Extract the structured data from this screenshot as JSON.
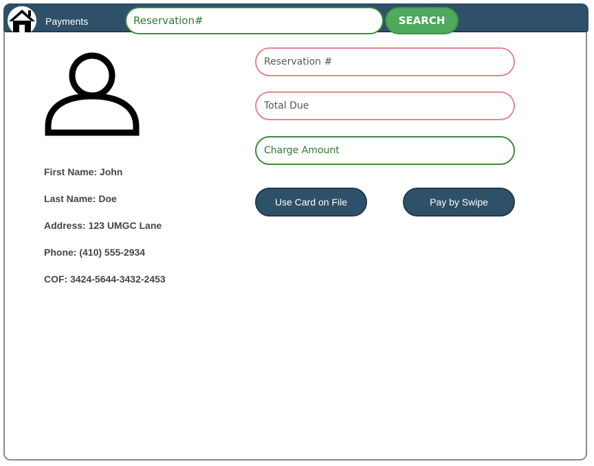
{
  "header": {
    "title": "Payments",
    "search_placeholder": "Reservation#",
    "search_button": "SEARCH",
    "home_icon": "home-icon"
  },
  "customer": {
    "avatar_icon": "user-icon",
    "first_name": "First Name: John",
    "last_name": "Last Name: Doe",
    "address": "Address: 123 UMGC Lane",
    "phone": "Phone: (410) 555-2934",
    "cof": "COF: 3424-5644-3432-2453"
  },
  "form": {
    "reservation_placeholder": "Reservation #",
    "total_due_placeholder": "Total Due",
    "charge_amount_placeholder": "Charge Amount",
    "use_card_button": "Use Card on File",
    "swipe_button": "Pay by Swipe"
  },
  "colors": {
    "header_bg": "#2e5068",
    "search_button_bg": "#4eaa5c",
    "required_border": "#e8858a",
    "active_border": "#3a8a3a",
    "action_button_bg": "#2e5068"
  }
}
